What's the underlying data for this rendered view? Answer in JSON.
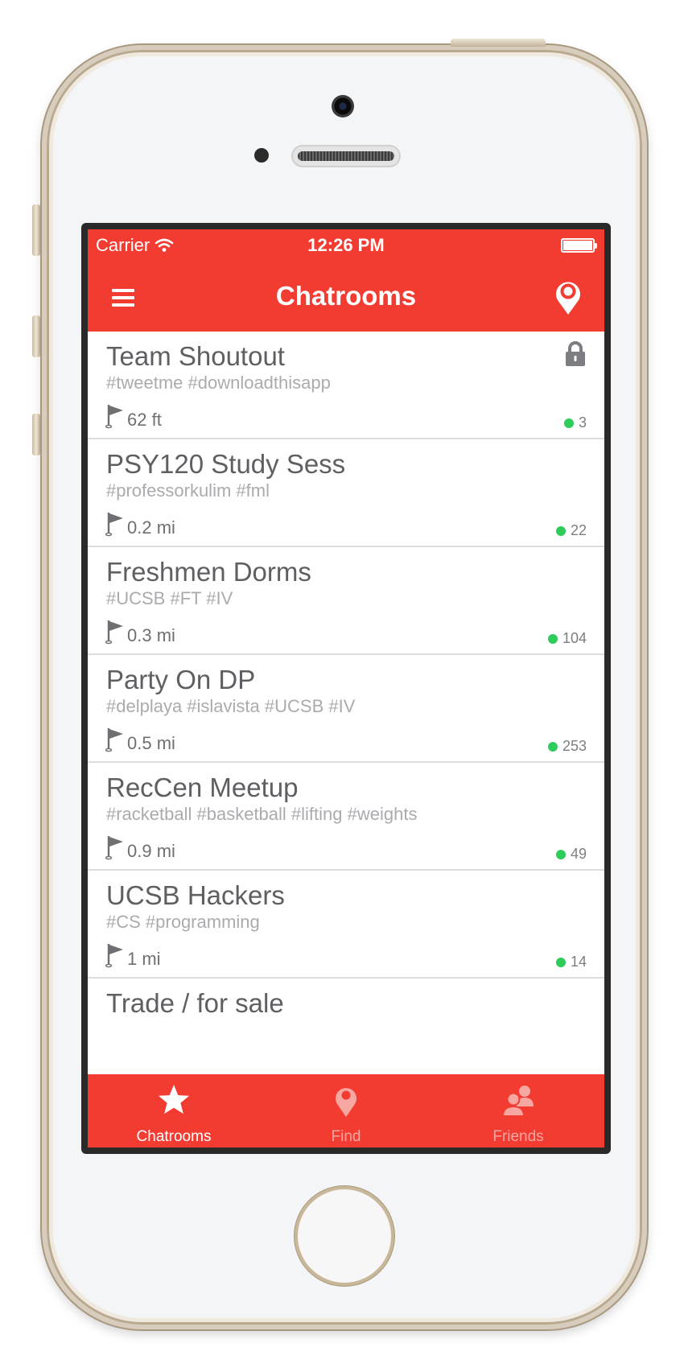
{
  "status_bar": {
    "carrier": "Carrier",
    "time": "12:26 PM"
  },
  "nav": {
    "title": "Chatrooms",
    "menu_icon": "hamburger-menu-icon",
    "location_icon": "location-pin-icon"
  },
  "rooms": [
    {
      "name": "Team Shoutout",
      "tags": "#tweetme #downloadthisapp",
      "distance": "62 ft",
      "count": "3",
      "locked": true
    },
    {
      "name": "PSY120 Study Sess",
      "tags": "#professorkulim #fml",
      "distance": "0.2 mi",
      "count": "22",
      "locked": false
    },
    {
      "name": "Freshmen Dorms",
      "tags": "#UCSB #FT #IV",
      "distance": "0.3 mi",
      "count": "104",
      "locked": false
    },
    {
      "name": "Party On DP",
      "tags": "#delplaya #islavista #UCSB #IV",
      "distance": "0.5 mi",
      "count": "253",
      "locked": false
    },
    {
      "name": "RecCen Meetup",
      "tags": "#racketball #basketball #lifting #weights",
      "distance": "0.9 mi",
      "count": "49",
      "locked": false
    },
    {
      "name": "UCSB Hackers",
      "tags": "#CS #programming",
      "distance": "1 mi",
      "count": "14",
      "locked": false
    },
    {
      "name": "Trade / for sale"
    }
  ],
  "tabs": [
    {
      "label": "Chatrooms",
      "icon": "star-icon",
      "active": true
    },
    {
      "label": "Find",
      "icon": "map-pin-icon",
      "active": false
    },
    {
      "label": "Friends",
      "icon": "friends-icon",
      "active": false
    }
  ],
  "colors": {
    "accent": "#f23c32",
    "online": "#2ecc5b",
    "text": "#5d5f62",
    "muted": "#a9abae"
  }
}
